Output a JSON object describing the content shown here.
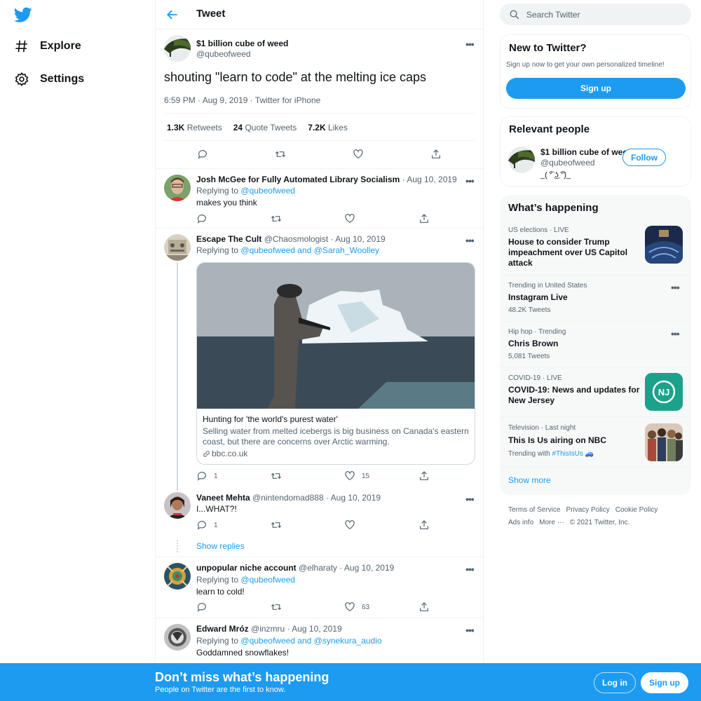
{
  "nav": {
    "items": [
      {
        "label": "Explore",
        "icon": "hashtag-icon"
      },
      {
        "label": "Settings",
        "icon": "gear-icon"
      }
    ]
  },
  "header": {
    "title": "Tweet"
  },
  "tweet": {
    "name": "$1 billion cube of weed",
    "handle": "@qubeofweed",
    "text": "shouting \"learn to code\" at the melting ice caps",
    "time": "6:59 PM",
    "date": "Aug 9, 2019",
    "source": "Twitter for iPhone",
    "separator": "·",
    "stats": {
      "retweets_count": "1.3K",
      "retweets_label": "Retweets",
      "quotes_count": "24",
      "quotes_label": "Quote Tweets",
      "likes_count": "7.2K",
      "likes_label": "Likes"
    }
  },
  "replies": [
    {
      "name": "Josh McGee for Fully Automated Library Socialism",
      "handle": "",
      "date": "Aug 10, 2019",
      "replying_prefix": "Replying to",
      "replying_to": "@qubeofweed",
      "text": "makes you think",
      "reply_count": "",
      "like_count": ""
    },
    {
      "name": "Escape The Cult",
      "handle": "@Chaosmologist",
      "date": "Aug 10, 2019",
      "replying_prefix": "Replying to",
      "replying_to": "@qubeofweed and @Sarah_Woolley",
      "text": "",
      "reply_count": "1",
      "like_count": "15",
      "card": {
        "title": "Hunting for 'the world's purest water'",
        "description": "Selling water from melted icebergs is big business on Canada's eastern coast, but there are concerns over Arctic warming.",
        "domain": "bbc.co.uk"
      }
    },
    {
      "name": "Vaneet Mehta",
      "handle": "@nintendomad888",
      "date": "Aug 10, 2019",
      "text": "I...WHAT?!",
      "reply_count": "1",
      "like_count": ""
    },
    {
      "name": "unpopular niche account",
      "handle": "@elharaty",
      "date": "Aug 10, 2019",
      "replying_prefix": "Replying to",
      "replying_to": "@qubeofweed",
      "text": "learn to cold!",
      "reply_count": "",
      "like_count": "63"
    },
    {
      "name": "Edward Mróz",
      "handle": "@inzmru",
      "date": "Aug 10, 2019",
      "replying_prefix": "Replying to",
      "replying_to": "@qubeofweed and @synekura_audio",
      "text": "Goddamned snowflakes!"
    }
  ],
  "show_replies": "Show replies",
  "sidebar": {
    "search_placeholder": "Search Twitter",
    "new_box": {
      "title": "New to Twitter?",
      "subtitle": "Sign up now to get your own personalized timeline!",
      "button": "Sign up"
    },
    "relevant": {
      "title": "Relevant people",
      "name": "$1 billion cube of weed",
      "handle": "@qubeofweed",
      "bio": "_( ͡° ͜ʖ ͡°)_",
      "button": "Follow"
    },
    "happening": {
      "title": "What’s happening",
      "trends": [
        {
          "meta": "US elections · LIVE",
          "title": "House to consider Trump impeachment over US Capitol attack",
          "sub": ""
        },
        {
          "meta": "Trending in United States",
          "title": "Instagram Live",
          "sub": "48.2K Tweets"
        },
        {
          "meta": "Hip hop · Trending",
          "title": "Chris Brown",
          "sub": "5,081 Tweets"
        },
        {
          "meta": "COVID-19 · LIVE",
          "title": "COVID-19: News and updates for New Jersey",
          "sub": "",
          "badge": "NJ"
        },
        {
          "meta": "Television · Last night",
          "title": "This Is Us airing on NBC",
          "sub_prefix": "Trending with",
          "sub_link": "#ThisIsUs"
        }
      ],
      "show_more": "Show more"
    },
    "footer": [
      "Terms of Service",
      "Privacy Policy",
      "Cookie Policy",
      "Ads info",
      "More ···",
      "© 2021 Twitter, Inc."
    ]
  },
  "bottom_bar": {
    "title": "Don’t miss what’s happening",
    "subtitle": "People on Twitter are the first to know.",
    "login": "Log in",
    "signup": "Sign up"
  },
  "colors": {
    "accent": "#1d9bf0",
    "text": "#0f1419",
    "secondary": "#536471",
    "border": "#eff3f4"
  }
}
